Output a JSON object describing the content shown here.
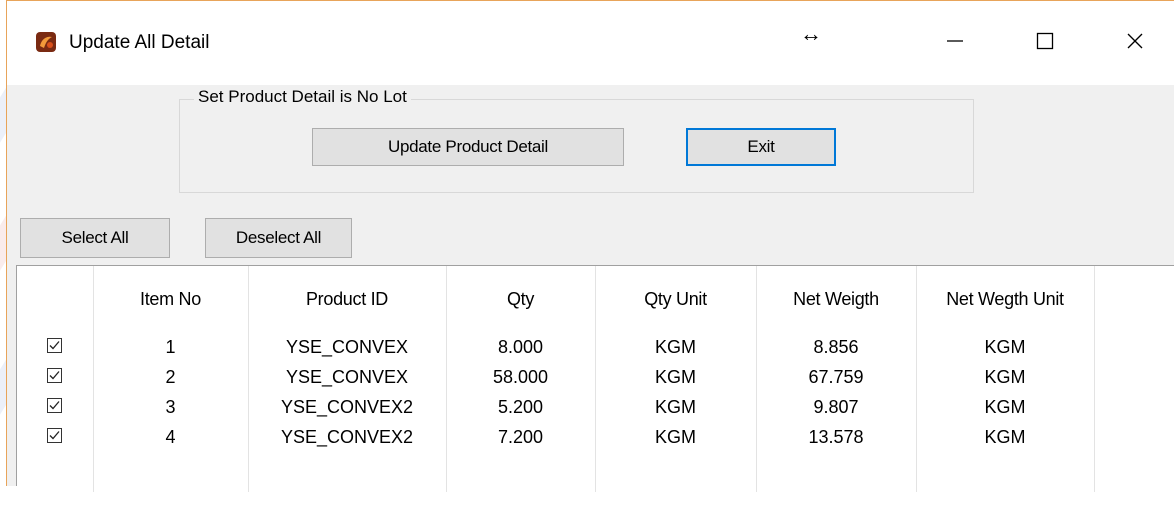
{
  "window": {
    "title": "Update All Detail",
    "icon": "app-icon"
  },
  "titlebar_controls": {
    "minimize": "minimize-icon",
    "maximize": "maximize-icon",
    "close": "close-icon",
    "cursor": "↔"
  },
  "group": {
    "legend": "Set Product Detail is No Lot",
    "update_button": "Update Product Detail",
    "exit_button": "Exit"
  },
  "selection": {
    "select_all": "Select All",
    "deselect_all": "Deselect All"
  },
  "table": {
    "columns": [
      "",
      "Item No",
      "Product ID",
      "Qty",
      "Qty Unit",
      "Net Weigth",
      "Net Wegth Unit"
    ],
    "rows": [
      {
        "checked": true,
        "item_no": "1",
        "product_id": "YSE_CONVEX",
        "qty": "8.000",
        "qty_unit": "KGM",
        "net_weight": "8.856",
        "net_weight_unit": "KGM"
      },
      {
        "checked": true,
        "item_no": "2",
        "product_id": "YSE_CONVEX",
        "qty": "58.000",
        "qty_unit": "KGM",
        "net_weight": "67.759",
        "net_weight_unit": "KGM"
      },
      {
        "checked": true,
        "item_no": "3",
        "product_id": "YSE_CONVEX2",
        "qty": "5.200",
        "qty_unit": "KGM",
        "net_weight": "9.807",
        "net_weight_unit": "KGM"
      },
      {
        "checked": true,
        "item_no": "4",
        "product_id": "YSE_CONVEX2",
        "qty": "7.200",
        "qty_unit": "KGM",
        "net_weight": "13.578",
        "net_weight_unit": "KGM"
      }
    ]
  },
  "colors": {
    "accent": "#0078d7",
    "window_border": "#e8a45a",
    "button_face": "#e1e1e1"
  }
}
